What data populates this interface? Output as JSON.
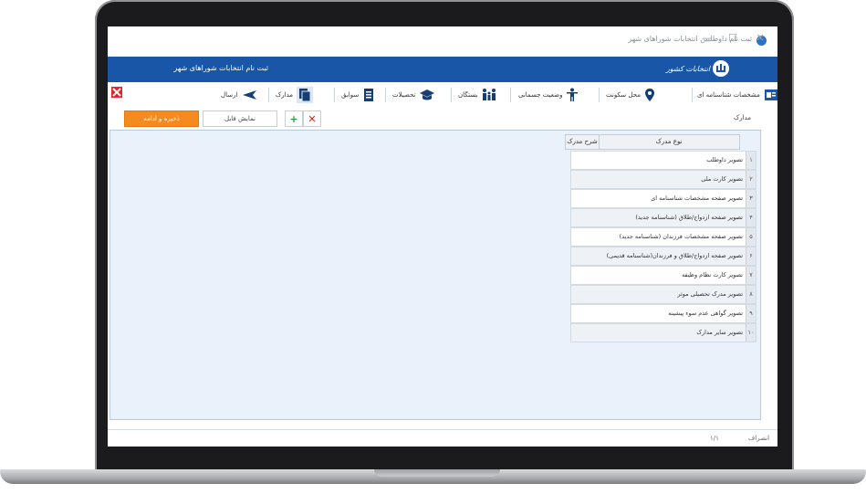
{
  "window": {
    "title": "ثبت نام داوطلبین انتخابات شوراهای شهر",
    "min": "—",
    "max": "☐",
    "close": "✕"
  },
  "header": {
    "title": "ثبت نام انتخابات شوراهای شهر",
    "brand": "ستاد انتخابات کشور"
  },
  "toolbar": {
    "items": [
      {
        "label": "مشخصات شناسنامه ای",
        "icon": "id-card-icon"
      },
      {
        "label": "محل سکونت",
        "icon": "location-pin-icon"
      },
      {
        "label": "وضعیت جسمانی",
        "icon": "person-icon"
      },
      {
        "label": "بستگان",
        "icon": "family-icon"
      },
      {
        "label": "تحصیلات",
        "icon": "graduation-cap-icon"
      },
      {
        "label": "سوابق",
        "icon": "records-icon"
      },
      {
        "label": "مدارک",
        "icon": "documents-icon"
      },
      {
        "label": "ارسال",
        "icon": "send-arrow-icon"
      }
    ]
  },
  "actions": {
    "save": "ذخیره و ادامه",
    "show_file": "نمایش فایل",
    "side_label": "مدارک"
  },
  "grid": {
    "columns": [
      "نوع مدرک",
      "شرح مدرک"
    ],
    "rows": [
      {
        "num": "۱",
        "type": "تصویر داوطلب"
      },
      {
        "num": "۲",
        "type": "تصویر کارت ملی"
      },
      {
        "num": "۳",
        "type": "تصویر صفحه مشخصات شناسنامه ای"
      },
      {
        "num": "۴",
        "type": "تصویر صفحه ازدواج/طلاق (شناسنامه جدید)"
      },
      {
        "num": "۵",
        "type": "تصویر صفحه مشخصات فرزندان (شناسنامه جدید)"
      },
      {
        "num": "۶",
        "type": "تصویر صفحه ازدواج/طلاق و فرزندان(شناسنامه قدیمی)"
      },
      {
        "num": "۷",
        "type": "تصویر کارت نظام وظیفه"
      },
      {
        "num": "۸",
        "type": "تصویر مدرک تحصیلی موثر"
      },
      {
        "num": "۹",
        "type": "تصویر گواهی عدم سوء پیشینه"
      },
      {
        "num": "۱۰",
        "type": "تصویر سایر مدارک"
      }
    ]
  },
  "status": {
    "left": "۱/۱",
    "right": "انصراف"
  },
  "colors": {
    "header_blue": "#1a56a7",
    "save_orange": "#f58a1f",
    "grid_bg": "#e9f1fb"
  }
}
